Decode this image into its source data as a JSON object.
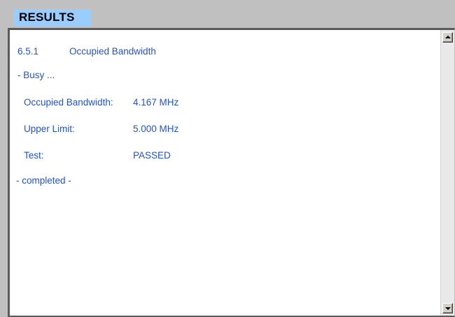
{
  "header": {
    "title": "RESULTS"
  },
  "results": {
    "section_number": "6.5.1",
    "section_title": "Occupied Bandwidth",
    "status_busy": "- Busy ...",
    "rows": [
      {
        "label": "Occupied Bandwidth:",
        "value": "4.167 MHz"
      },
      {
        "label": "Upper Limit:",
        "value": "5.000 MHz"
      },
      {
        "label": "Test:",
        "value": "PASSED"
      }
    ],
    "status_completed": "- completed -"
  },
  "scrollbar": {
    "up_icon": "arrow-up-icon",
    "down_icon": "arrow-down-icon"
  },
  "colors": {
    "text": "#2453c9",
    "title_bg": "#99ccff",
    "window_bg": "#c0c0c0"
  }
}
